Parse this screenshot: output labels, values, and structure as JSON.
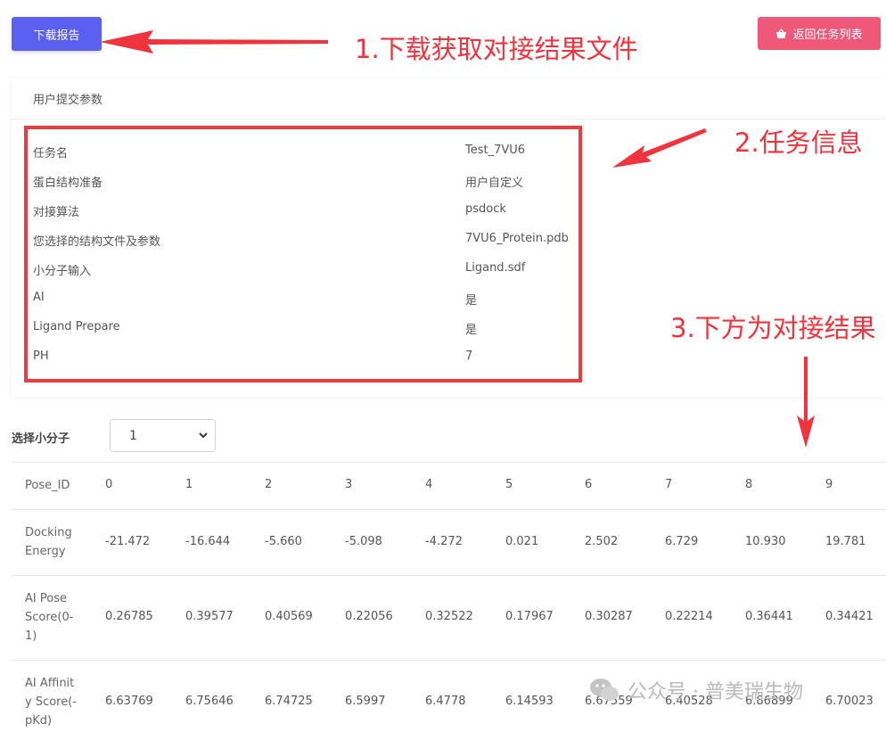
{
  "header": {
    "download_label": "下载报告",
    "back_label": "返回任务列表",
    "back_icon": "basket-icon"
  },
  "annotations": {
    "one": "1.下载获取对接结果文件",
    "two": "2.任务信息",
    "three": "3.下方为对接结果"
  },
  "params_panel": {
    "title": "用户提交参数",
    "rows": [
      {
        "key": "任务名",
        "value": "Test_7VU6"
      },
      {
        "key": "蛋白结构准备",
        "value": "用户自定义"
      },
      {
        "key": "对接算法",
        "value": "psdock"
      },
      {
        "key": "您选择的结构文件及参数",
        "value": "7VU6_Protein.pdb"
      },
      {
        "key": "小分子输入",
        "value": "Ligand.sdf"
      },
      {
        "key": "AI",
        "value": "是"
      },
      {
        "key": "Ligand Prepare",
        "value": "是"
      },
      {
        "key": "PH",
        "value": "7"
      }
    ]
  },
  "ligand_select": {
    "label": "选择小分子",
    "value": "1"
  },
  "results": {
    "rows": [
      {
        "header": "Pose_ID",
        "cells": [
          "0",
          "1",
          "2",
          "3",
          "4",
          "5",
          "6",
          "7",
          "8",
          "9"
        ]
      },
      {
        "header": "Docking Energy",
        "cells": [
          "-21.472",
          "-16.644",
          "-5.660",
          "-5.098",
          "-4.272",
          "0.021",
          "2.502",
          "6.729",
          "10.930",
          "19.781"
        ]
      },
      {
        "header": "AI Pose Score(0-1)",
        "cells": [
          "0.26785",
          "0.39577",
          "0.40569",
          "0.22056",
          "0.32522",
          "0.17967",
          "0.30287",
          "0.22214",
          "0.36441",
          "0.34421"
        ]
      },
      {
        "header": "AI Affinity Score(-pKd)",
        "cells": [
          "6.63769",
          "6.75646",
          "6.74725",
          "6.5997",
          "6.4778",
          "6.14593",
          "6.67559",
          "6.40528",
          "6.86899",
          "6.70023"
        ]
      }
    ]
  },
  "watermark": {
    "text": "公众号 · 普美瑞生物"
  },
  "colors": {
    "download_btn": "#5b5ff0",
    "back_btn": "#f0587a",
    "annotation_red": "#f0333d"
  }
}
